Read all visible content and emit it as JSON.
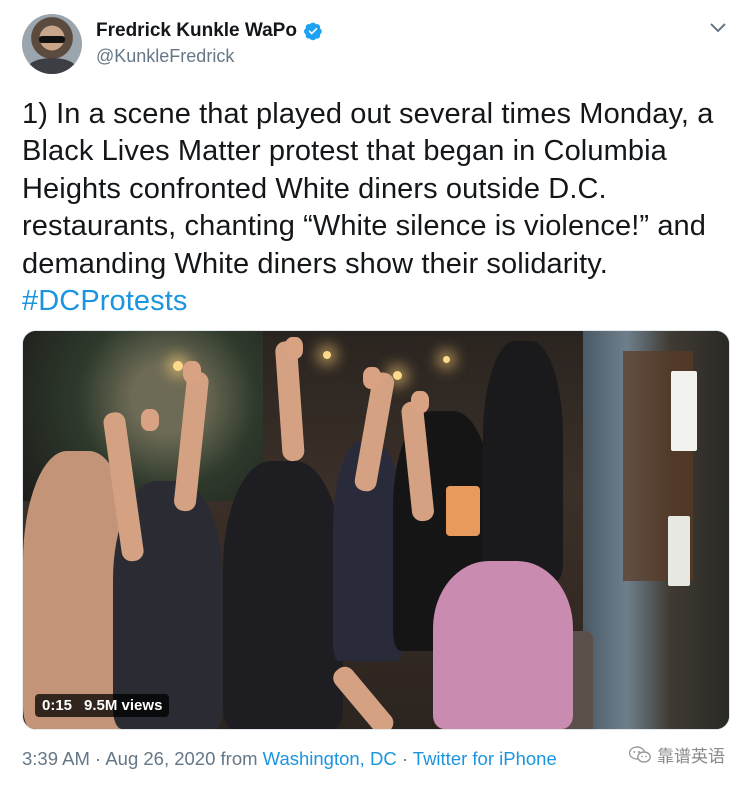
{
  "author": {
    "display_name": "Fredrick Kunkle WaPo",
    "handle": "@KunkleFredrick",
    "avatar_icon": "avatar-photo",
    "verified_icon": "verified-badge-icon"
  },
  "tweet": {
    "text_main": "1) In a scene that played out several times Monday, a Black Lives Matter protest that began in Columbia Heights confronted White diners outside D.C. restaurants,  chanting “White silence is violence!” and demanding White diners show their solidarity. ",
    "hashtag": "#DCProtests"
  },
  "media": {
    "type": "video",
    "duration": "0:15",
    "views": "9.5M views"
  },
  "meta": {
    "time": "3:39 AM",
    "separator1": " · ",
    "date": "Aug 26, 2020",
    "from_text": " from ",
    "location": "Washington, DC",
    "separator2": " · ",
    "source": "Twitter for iPhone"
  },
  "watermark": {
    "text": "靠谱英语",
    "icon": "wechat-icon"
  },
  "colors": {
    "link": "#1b95e0",
    "secondary_text": "#657786",
    "verified": "#1da1f2"
  }
}
